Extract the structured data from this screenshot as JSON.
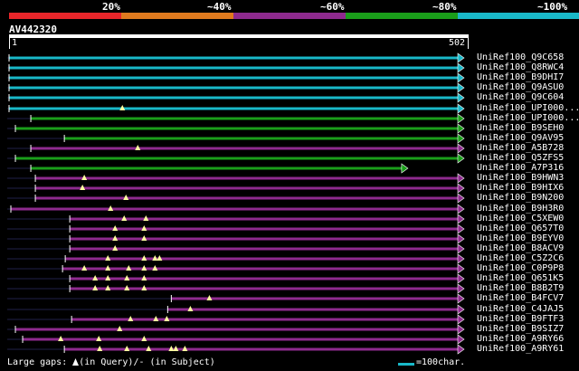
{
  "scale": {
    "labels": [
      "20%",
      "~40%",
      "~60%",
      "~80%",
      "~100%"
    ],
    "colors": [
      "#e8262a",
      "#e07a1e",
      "#8e2a8e",
      "#1a9e1a",
      "#19b8c8"
    ]
  },
  "query": {
    "name": "AV442320",
    "start": "1",
    "end": "502"
  },
  "hits": [
    {
      "label": "UniRef100_Q9C658",
      "color": "#19b8c8",
      "start": 1,
      "end": 502,
      "arrow": true,
      "gaps": []
    },
    {
      "label": "UniRef100_Q8RWC4",
      "color": "#19b8c8",
      "start": 1,
      "end": 502,
      "arrow": true,
      "gaps": []
    },
    {
      "label": "UniRef100_B9DHI7",
      "color": "#19b8c8",
      "start": 1,
      "end": 502,
      "arrow": true,
      "gaps": []
    },
    {
      "label": "UniRef100_Q9ASU0",
      "color": "#19b8c8",
      "start": 1,
      "end": 502,
      "arrow": true,
      "gaps": []
    },
    {
      "label": "UniRef100_Q9C604",
      "color": "#19b8c8",
      "start": 1,
      "end": 502,
      "arrow": true,
      "gaps": []
    },
    {
      "label": "UniRef100_UPI000...",
      "color": "#19b8c8",
      "start": 1,
      "end": 502,
      "arrow": true,
      "gaps": [
        126
      ]
    },
    {
      "label": "UniRef100_UPI000...",
      "color": "#1a9e1a",
      "start": 25,
      "end": 502,
      "arrow": true,
      "gaps": []
    },
    {
      "label": "UniRef100_B9SEH0",
      "color": "#1a9e1a",
      "start": 8,
      "end": 502,
      "arrow": true,
      "gaps": []
    },
    {
      "label": "UniRef100_Q9AV95",
      "color": "#1a9e1a",
      "start": 62,
      "end": 502,
      "arrow": true,
      "gaps": []
    },
    {
      "label": "UniRef100_A5B728",
      "color": "#8e2a8e",
      "start": 25,
      "end": 502,
      "arrow": true,
      "gaps": [
        143
      ]
    },
    {
      "label": "UniRef100_Q5ZFS5",
      "color": "#1a9e1a",
      "start": 8,
      "end": 502,
      "arrow": true,
      "gaps": []
    },
    {
      "label": "UniRef100_A7P316",
      "color": "#1a9e1a",
      "start": 25,
      "end": 440,
      "arrow": true,
      "gaps": []
    },
    {
      "label": "UniRef100_B9HWN3",
      "color": "#8e2a8e",
      "start": 30,
      "end": 502,
      "arrow": true,
      "gaps": [
        84
      ]
    },
    {
      "label": "UniRef100_B9HIX6",
      "color": "#8e2a8e",
      "start": 30,
      "end": 502,
      "arrow": true,
      "gaps": [
        82
      ]
    },
    {
      "label": "UniRef100_B9N200",
      "color": "#8e2a8e",
      "start": 30,
      "end": 502,
      "arrow": true,
      "gaps": [
        130
      ]
    },
    {
      "label": "UniRef100_B9H3R0",
      "color": "#8e2a8e",
      "start": 3,
      "end": 502,
      "arrow": true,
      "gaps": [
        113
      ]
    },
    {
      "label": "UniRef100_C5XEW0",
      "color": "#8e2a8e",
      "start": 68,
      "end": 502,
      "arrow": true,
      "gaps": [
        128,
        152
      ]
    },
    {
      "label": "UniRef100_Q657T0",
      "color": "#8e2a8e",
      "start": 68,
      "end": 502,
      "arrow": true,
      "gaps": [
        118,
        150
      ]
    },
    {
      "label": "UniRef100_B9EYV0",
      "color": "#8e2a8e",
      "start": 68,
      "end": 502,
      "arrow": true,
      "gaps": [
        118,
        150
      ]
    },
    {
      "label": "UniRef100_B8ACV9",
      "color": "#8e2a8e",
      "start": 68,
      "end": 502,
      "arrow": true,
      "gaps": [
        118
      ]
    },
    {
      "label": "UniRef100_C5Z2C6",
      "color": "#8e2a8e",
      "start": 63,
      "end": 502,
      "arrow": true,
      "gaps": [
        110,
        150,
        162,
        167
      ]
    },
    {
      "label": "UniRef100_C0P9P8",
      "color": "#8e2a8e",
      "start": 60,
      "end": 502,
      "arrow": true,
      "gaps": [
        84,
        110,
        133,
        150,
        162
      ]
    },
    {
      "label": "UniRef100_Q651K5",
      "color": "#8e2a8e",
      "start": 68,
      "end": 502,
      "arrow": true,
      "gaps": [
        96,
        110,
        131,
        150
      ]
    },
    {
      "label": "UniRef100_B8B2T9",
      "color": "#8e2a8e",
      "start": 68,
      "end": 502,
      "arrow": true,
      "gaps": [
        96,
        110,
        131,
        150
      ]
    },
    {
      "label": "UniRef100_B4FCV7",
      "color": "#8e2a8e",
      "start": 180,
      "end": 502,
      "arrow": true,
      "gaps": [
        222
      ]
    },
    {
      "label": "UniRef100_C4JAJ5",
      "color": "#8e2a8e",
      "start": 176,
      "end": 502,
      "arrow": true,
      "gaps": [
        201
      ]
    },
    {
      "label": "UniRef100_B9FTF3",
      "color": "#8e2a8e",
      "start": 70,
      "end": 502,
      "arrow": true,
      "gaps": [
        135,
        163,
        175
      ]
    },
    {
      "label": "UniRef100_B9SIZ7",
      "color": "#8e2a8e",
      "start": 8,
      "end": 502,
      "arrow": true,
      "gaps": [
        123
      ]
    },
    {
      "label": "UniRef100_A9RY66",
      "color": "#8e2a8e",
      "start": 16,
      "end": 502,
      "arrow": true,
      "gaps": [
        58,
        100,
        150
      ]
    },
    {
      "label": "UniRef100_A9RY61",
      "color": "#8e2a8e",
      "start": 62,
      "end": 502,
      "arrow": true,
      "gaps": [
        101,
        131,
        155,
        180,
        185,
        195
      ]
    }
  ],
  "footer": {
    "gaps_prefix": "Large gaps: ",
    "gaps_query": "(in Query)/",
    "gaps_subject": "- (in Subject)",
    "legend": "=100char."
  }
}
